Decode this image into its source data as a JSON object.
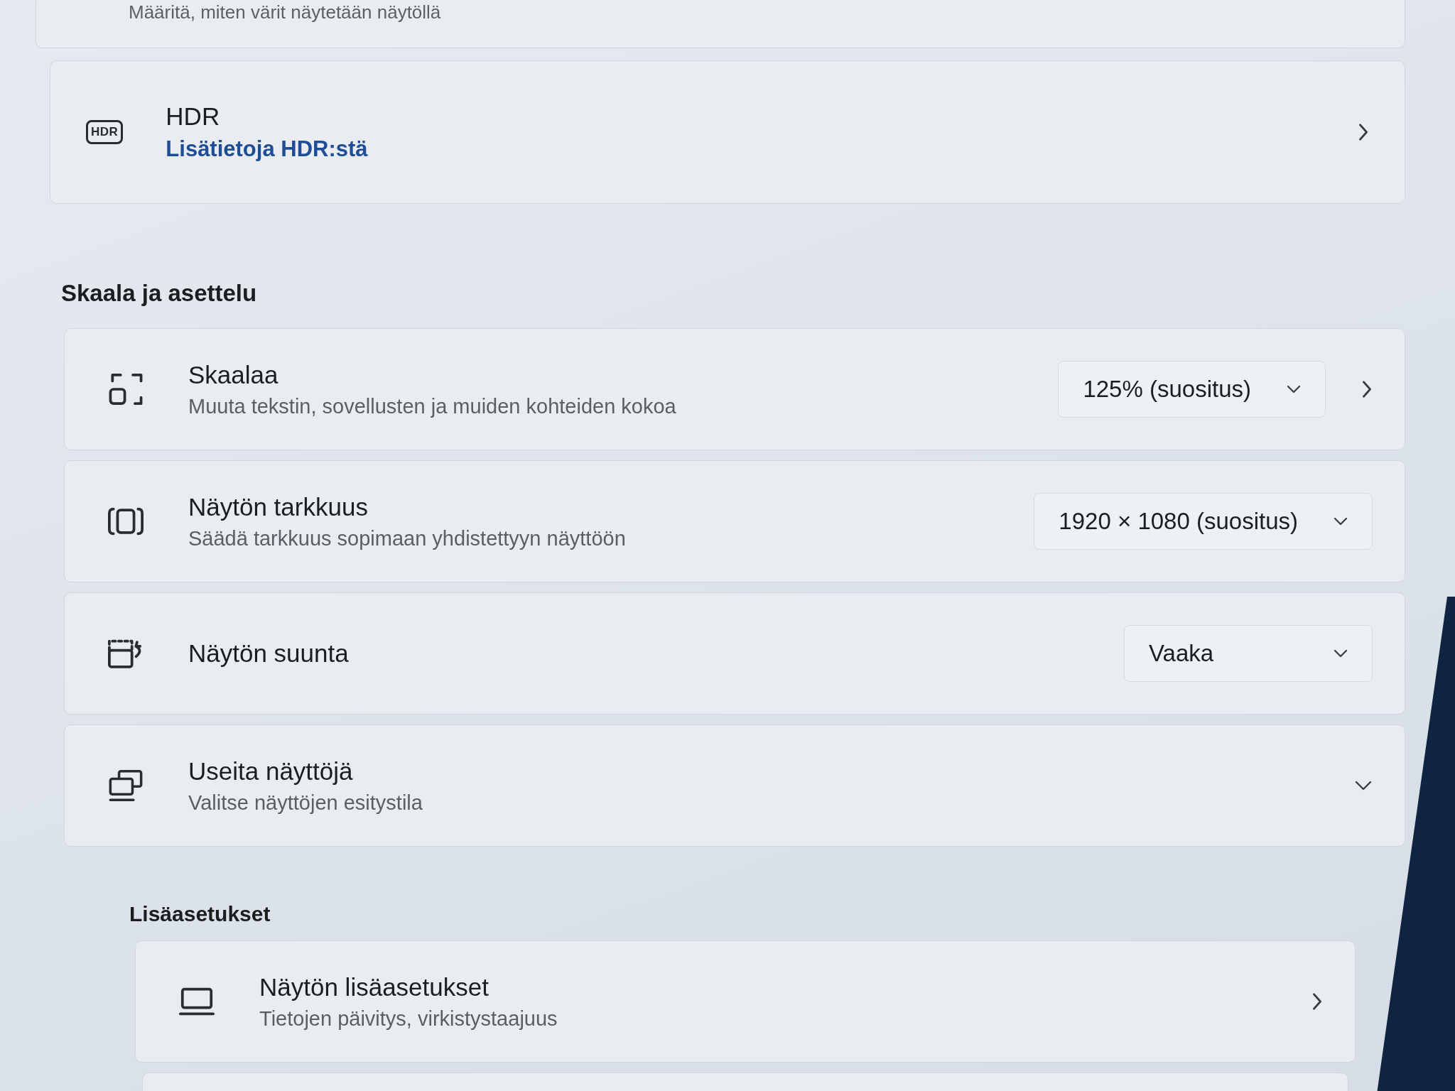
{
  "top_card": {
    "description": "Määritä, miten värit näytetään näytöllä"
  },
  "hdr": {
    "icon_label": "HDR",
    "title": "HDR",
    "link": "Lisätietoja HDR:stä"
  },
  "sections": [
    {
      "heading": "Skaala ja asettelu",
      "items": [
        {
          "kind": "dropdown_link",
          "title": "Skaalaa",
          "description": "Muuta tekstin, sovellusten ja muiden kohteiden kokoa",
          "value": "125% (suositus)"
        },
        {
          "kind": "dropdown",
          "title": "Näytön tarkkuus",
          "description": "Säädä tarkkuus sopimaan yhdistettyyn näyttöön",
          "value": "1920 × 1080 (suositus)"
        },
        {
          "kind": "dropdown",
          "title": "Näytön suunta",
          "value": "Vaaka"
        },
        {
          "kind": "expander",
          "title": "Useita näyttöjä",
          "description": "Valitse näyttöjen esitystila",
          "expanded": false
        }
      ]
    },
    {
      "heading": "Lisäasetukset",
      "items": [
        {
          "kind": "link",
          "title": "Näytön lisäasetukset",
          "description": "Tietojen päivitys, virkistystaajuus"
        }
      ]
    }
  ]
}
